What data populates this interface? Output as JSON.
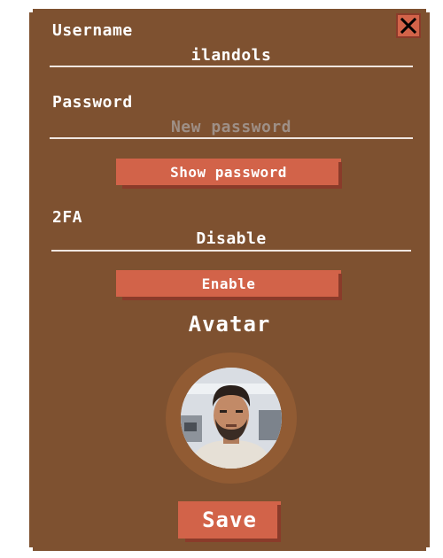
{
  "form": {
    "username": {
      "label": "Username",
      "value": "ilandols"
    },
    "password": {
      "label": "Password",
      "placeholder": "New password",
      "value": ""
    },
    "show_password_label": "Show password",
    "twofa": {
      "label": "2FA",
      "status": "Disable"
    },
    "enable_label": "Enable",
    "avatar_title": "Avatar",
    "save_label": "Save"
  },
  "colors": {
    "panel": "#7e5130",
    "button": "#d26349",
    "button_shadow": "#8a3b2a",
    "placeholder": "#9e8f86"
  },
  "icons": {
    "close": "close-icon",
    "avatar": "user-photo"
  }
}
